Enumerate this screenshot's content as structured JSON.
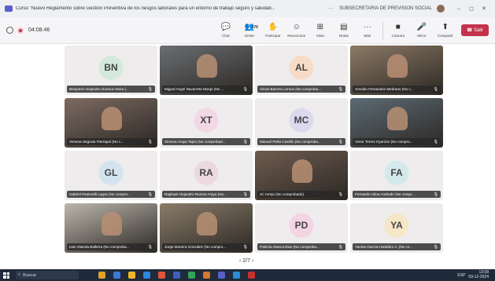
{
  "window": {
    "title": "Curso \"Nuevo Reglamento sobre Gestión Preventiva de los riesgos laborales para un entorno de trabajo seguro y saludab...",
    "more": "···",
    "org": "SUBSECRETARIA DE PREVISION SOCIAL",
    "minimize": "–",
    "close": "✕"
  },
  "toolbar": {
    "timer": "04:08:46",
    "buttons": [
      {
        "id": "chat",
        "label": "Chat",
        "icon": "chat-icon",
        "glyph": "💬"
      },
      {
        "id": "people",
        "label": "Gente",
        "icon": "people-icon",
        "glyph": "👥",
        "count": "176"
      },
      {
        "id": "raise",
        "label": "Participar",
        "icon": "hand-icon",
        "glyph": "✋"
      },
      {
        "id": "react",
        "label": "Reaccionar",
        "icon": "smile-icon",
        "glyph": "☺"
      },
      {
        "id": "view",
        "label": "Vista",
        "icon": "grid-icon",
        "glyph": "⊞"
      },
      {
        "id": "notes",
        "label": "Notas",
        "icon": "notes-icon",
        "glyph": "▤"
      },
      {
        "id": "more",
        "label": "Más",
        "icon": "more-icon",
        "glyph": "···"
      }
    ],
    "camera": {
      "label": "Cámara",
      "glyph": "■"
    },
    "mic": {
      "label": "Micro",
      "glyph": "🎤"
    },
    "share": {
      "label": "Compartir",
      "glyph": "⬆"
    },
    "leave": "Salir",
    "leave_glyph": "☎"
  },
  "participants": [
    {
      "name": "Benjamin Alejandro Guiroux Neira (...",
      "initials": "BN",
      "color": "#d4e9dd",
      "video": false
    },
    {
      "name": "Miguel Angel Navarrete Monje (No ...",
      "initials": "",
      "color": "#6a6e72",
      "video": true
    },
    {
      "name": "Alexis Barrera Lemus (No comproba...",
      "initials": "AL",
      "color": "#f6dcc7",
      "video": false
    },
    {
      "name": "Arnoldo Fernandez Medrano (No c...",
      "initials": "",
      "color": "#8c7a66",
      "video": true
    },
    {
      "name": "Ximena Segovia Pierrapol (No c...",
      "initials": "",
      "color": "#7d6b62",
      "video": true
    },
    {
      "name": "Ximena Araya Tapia (No comprobad...",
      "initials": "XT",
      "color": "#f3d7e4",
      "video": false
    },
    {
      "name": "Manuel Peña Castillo (No comproba...",
      "initials": "MC",
      "color": "#dcd9ec",
      "video": false
    },
    {
      "name": "Victor Torres Oyarzún (No compro...",
      "initials": "",
      "color": "#5c6b74",
      "video": true
    },
    {
      "name": "Gabriel Pastorelli Lagos (No compro...",
      "initials": "GL",
      "color": "#d3e4ee",
      "video": false
    },
    {
      "name": "Raphael Alejandro Ramos Araya (No...",
      "initials": "RA",
      "color": "#ecd9de",
      "video": false
    },
    {
      "name": "JC Arrejo (No comprobado)",
      "initials": "",
      "color": "#6e5c50",
      "video": true
    },
    {
      "name": "Fernando Ulloa Andrade (No compr...",
      "initials": "FA",
      "color": "#d4e9eb",
      "video": false
    },
    {
      "name": "Ivan Otarola Ballerra (No comproba...",
      "initials": "",
      "color": "#bcb7ad",
      "video": true
    },
    {
      "name": "Jorge Moreira Gonzalez (No compro...",
      "initials": "",
      "color": "#8a7c6a",
      "video": true
    },
    {
      "name": "Patricia Abarca Diaz (No comproba...",
      "initials": "PD",
      "color": "#f3d4e2",
      "video": false
    },
    {
      "name": "Yanina García-Huidobro A. (No co...",
      "initials": "YA",
      "color": "#f5e7c7",
      "video": false
    }
  ],
  "pager": {
    "text": "2/7",
    "prev": "‹",
    "next": "›"
  },
  "taskbar": {
    "search": "Buscar",
    "lang": "ESP",
    "time": "13:08",
    "date": "09-12-2024",
    "apps": [
      "#e2a12a",
      "#3b78d8",
      "#f0b428",
      "#2d86e0",
      "#e0553a",
      "#3f5fbf",
      "#31a35a",
      "#d4762f",
      "#5b5fc7",
      "#2a8bd6",
      "#c9302c"
    ]
  }
}
